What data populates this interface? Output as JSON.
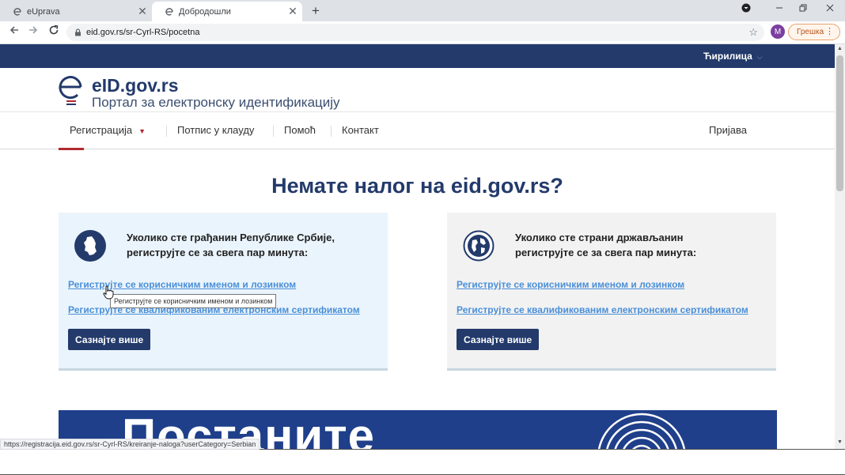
{
  "browser": {
    "tabs": [
      {
        "title": "eUprava",
        "close": "✕"
      },
      {
        "title": "Добродошли",
        "close": "✕"
      }
    ],
    "new_tab": "+",
    "url": "eid.gov.rs/sr-Cyrl-RS/pocetna",
    "profile_initial": "M",
    "error_label": "Грешка",
    "status_url": "https://registracija.eid.gov.rs/sr-Cyrl-RS/kreiranje-naloga?userCategory=Serbian"
  },
  "site": {
    "language": "Ћирилица",
    "name": "eID.gov.rs",
    "subtitle": "Портал за електронску идентификацију",
    "nav": {
      "registration": "Регистрација",
      "cloud_signature": "Потпис у клауду",
      "help": "Помоћ",
      "contact": "Контакт",
      "login": "Пријава"
    },
    "title": "Немате налог на eid.gov.rs?",
    "cards": [
      {
        "lead_line1": "Уколико сте грађанин Републике Србије,",
        "lead_line2": "региструјте се за свега пар минута:",
        "link_username": "Региструјте се корисничким именом и лозинком",
        "link_certificate": "Региструјте се квалификованим електронским сертификатом",
        "button": "Сазнајте више"
      },
      {
        "lead_line1": "Уколико сте страни држављанин",
        "lead_line2": "региструјте се за свега пар минута:",
        "link_username": "Региструјте се корисничким именом и лозинком",
        "link_certificate": "Региструјте се квалификованим електронским сертификатом",
        "button": "Сазнајте више"
      }
    ],
    "tooltip": "Региструјте се корисничким именом и лозинком",
    "banner_text": "Постаните"
  },
  "colors": {
    "brand_navy": "#233a6b",
    "accent_red": "#b02a30",
    "link_blue": "#4a8fd8"
  }
}
